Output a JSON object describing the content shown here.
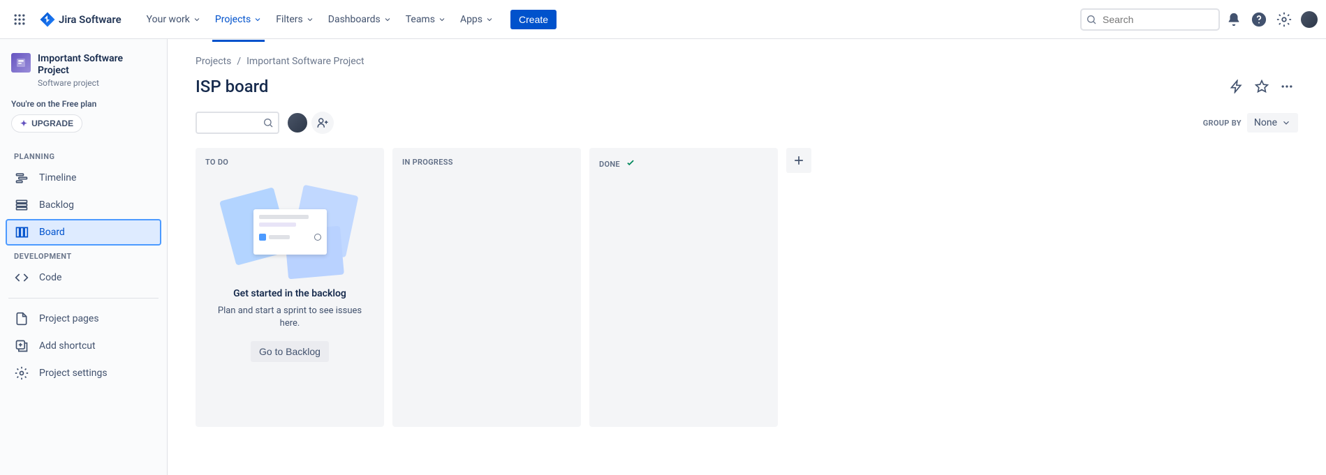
{
  "logo_text": "Jira Software",
  "nav": {
    "your_work": "Your work",
    "projects": "Projects",
    "filters": "Filters",
    "dashboards": "Dashboards",
    "teams": "Teams",
    "apps": "Apps",
    "create": "Create"
  },
  "search_placeholder": "Search",
  "sidebar": {
    "project_name": "Important Software Project",
    "project_type": "Software project",
    "plan_notice": "You're on the Free plan",
    "upgrade": "UPGRADE",
    "planning_label": "PLANNING",
    "development_label": "DEVELOPMENT",
    "items": {
      "timeline": "Timeline",
      "backlog": "Backlog",
      "board": "Board",
      "code": "Code",
      "project_pages": "Project pages",
      "add_shortcut": "Add shortcut",
      "project_settings": "Project settings"
    }
  },
  "breadcrumb": {
    "projects": "Projects",
    "project": "Important Software Project"
  },
  "page_title": "ISP board",
  "group_by_label": "GROUP BY",
  "group_by_value": "None",
  "columns": {
    "todo": "TO DO",
    "in_progress": "IN PROGRESS",
    "done": "DONE"
  },
  "empty_state": {
    "title": "Get started in the backlog",
    "desc": "Plan and start a sprint to see issues here.",
    "button": "Go to Backlog"
  }
}
